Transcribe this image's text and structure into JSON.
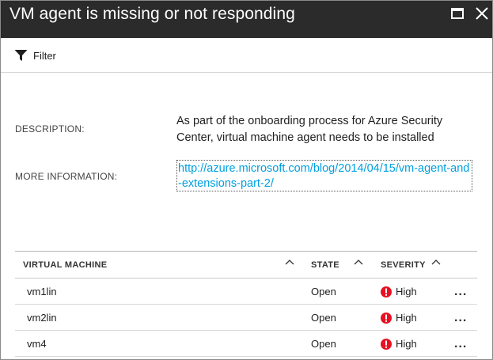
{
  "blade": {
    "title": "VM agent is missing or not responding"
  },
  "commandbar": {
    "filter_label": "Filter"
  },
  "properties": {
    "description_label": "DESCRIPTION:",
    "description_value": "As part of the onboarding process for Azure Security Center, virtual machine agent needs to be installed",
    "more_info_label": "MORE INFORMATION:",
    "more_info_link": "http://azure.microsoft.com/blog/2014/04/15/vm-agent-and-extensions-part-2/"
  },
  "grid": {
    "columns": [
      "VIRTUAL MACHINE",
      "STATE",
      "SEVERITY"
    ],
    "rows": [
      {
        "vm": "vm1lin",
        "state": "Open",
        "severity": "High",
        "more": "..."
      },
      {
        "vm": "vm2lin",
        "state": "Open",
        "severity": "High",
        "more": "..."
      },
      {
        "vm": "vm4",
        "state": "Open",
        "severity": "High",
        "more": "..."
      }
    ]
  },
  "icons": {
    "maximize": "maximize-icon",
    "close": "close-icon",
    "filter": "filter-icon",
    "sort": "chevron-up-icon",
    "severity": "error-circle-icon"
  },
  "colors": {
    "titlebar_bg": "#2b2b2b",
    "link": "#00a0e0",
    "severity_high": "#e81123"
  }
}
